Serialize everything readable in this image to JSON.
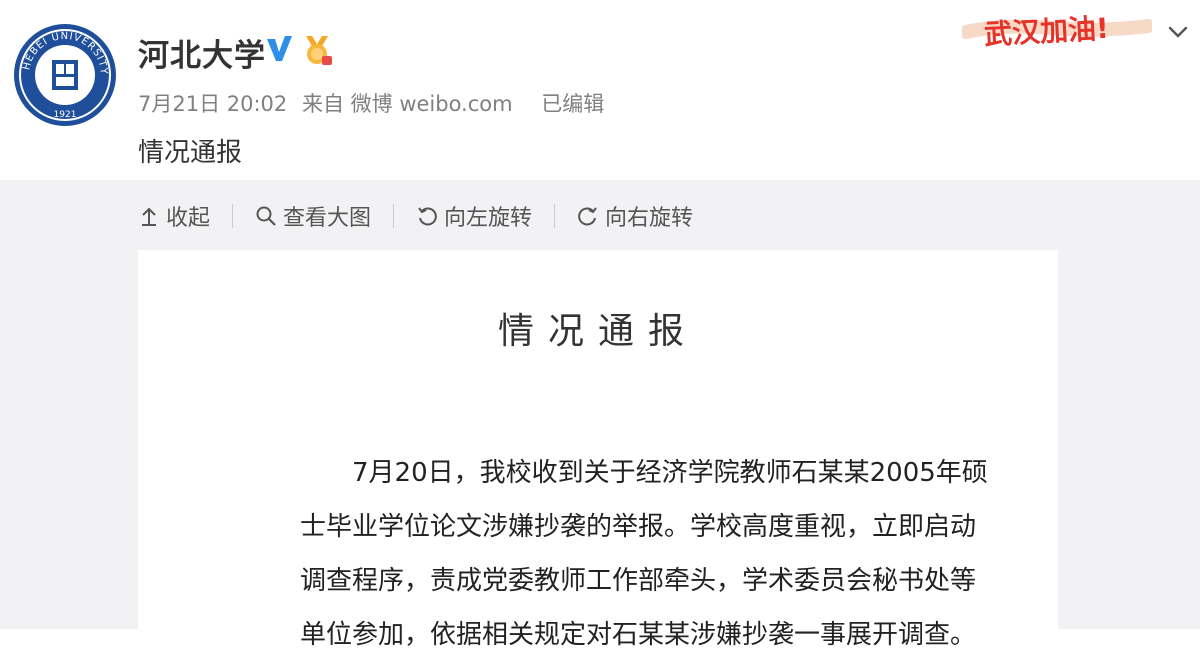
{
  "header": {
    "username": "河北大学",
    "date": "7月21日 20:02",
    "source": "来自 微博 weibo.com",
    "edited": "已编辑",
    "post_text": "情况通报",
    "campaign": "武汉加油!",
    "avatar_ring_text": "HEBEI UNIVERSITY",
    "avatar_year": "1921"
  },
  "toolbar": {
    "collapse": "收起",
    "view_large": "查看大图",
    "rotate_left": "向左旋转",
    "rotate_right": "向右旋转"
  },
  "document": {
    "title": "情况通报",
    "lines": [
      "7月20日，我校收到关于经济学院教师石某某2005年硕",
      "士毕业学位论文涉嫌抄袭的举报。学校高度重视，立即启动",
      "调查程序，责成党委教师工作部牵头，学术委员会秘书处等",
      "单位参加，依据相关规定对石某某涉嫌抄袭一事展开调查。"
    ]
  },
  "colors": {
    "verified": "#2f8fe8",
    "campaign": "#e6332a",
    "avatar_blue": "#1f4e9a",
    "media_bg": "#f2f2f5"
  },
  "icons": {
    "verified": "verified-v-icon",
    "medal": "medal-icon",
    "collapse": "arrow-up-icon",
    "view_large": "magnifier-icon",
    "rotate_left": "rotate-left-icon",
    "rotate_right": "rotate-right-icon",
    "more": "chevron-down-icon"
  }
}
